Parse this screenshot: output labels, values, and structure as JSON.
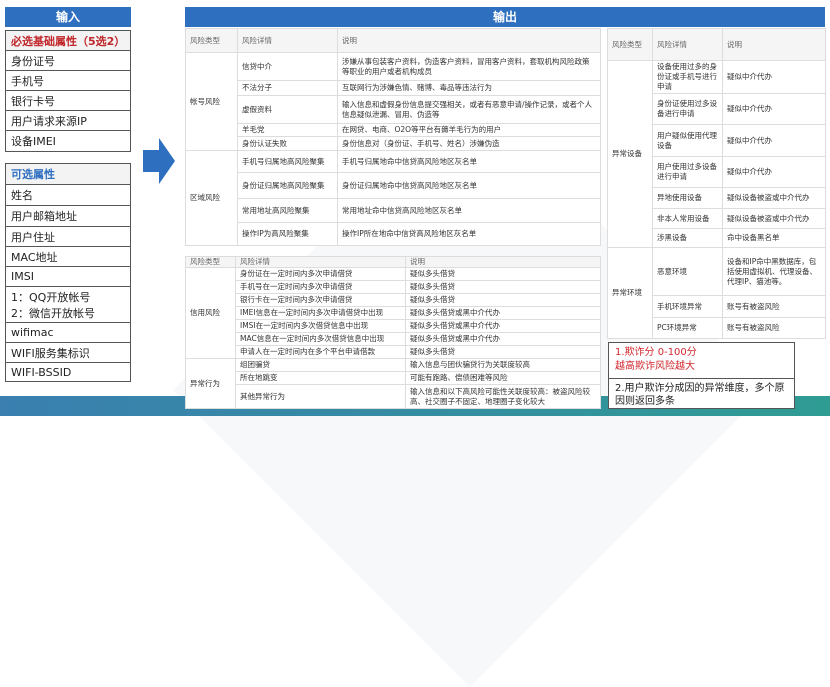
{
  "input": {
    "title": "输入",
    "required_title": "必选基础属性（5选2）",
    "required": [
      "身份证号",
      "手机号",
      "银行卡号",
      "用户请求来源IP",
      "设备IMEI"
    ],
    "optional_title": "可选属性",
    "optional": [
      "姓名",
      "用户邮箱地址",
      "用户住址",
      "MAC地址",
      "IMSI",
      "1：QQ开放帐号",
      "2：微信开放帐号",
      "wifimac",
      "WIFI服务集标识",
      "WIFI-BSSID"
    ]
  },
  "output": {
    "title": "输出"
  },
  "headers": [
    "风险类型",
    "风险详情",
    "说明"
  ],
  "table1": {
    "groups": [
      {
        "type": "帐号风险",
        "rows": [
          [
            "信贷中介",
            "涉嫌从事包装客户资料，伪造客户资料，冒用客户资料，套取机构风险政策等职业的用户或者机构成员"
          ],
          [
            "不法分子",
            "互联网行为涉嫌色情、赌博、毒品等违法行为"
          ],
          [
            "虚假资料",
            "输入信息和虚假身份信息提交强相关，或者有恶意申请/操作记录，或者个人信息疑似泄漏、冒用、伪造等"
          ],
          [
            "羊毛党",
            "在网贷、电商、O2O等平台有薅羊毛行为的用户"
          ],
          [
            "身份认证失败",
            "身份信息对（身份证、手机号、姓名）涉嫌伪造"
          ]
        ]
      },
      {
        "type": "区域风险",
        "rows": [
          [
            "手机号归属地高风险聚集",
            "手机号归属地命中信贷高风险地区灰名单"
          ],
          [
            "身份证归属地高风险聚集",
            "身份证归属地命中信贷高风险地区灰名单"
          ],
          [
            "常用地址高风险聚集",
            "常用地址命中信贷高风险地区灰名单"
          ],
          [
            "操作IP为高风险聚集",
            "操作IP所在地命中信贷高风险地区灰名单"
          ]
        ]
      }
    ]
  },
  "table2": {
    "groups": [
      {
        "type": "信用风险",
        "rows": [
          [
            "身份证在一定时间内多次申请借贷",
            "疑似多头借贷"
          ],
          [
            "手机号在一定时间内多次申请借贷",
            "疑似多头借贷"
          ],
          [
            "银行卡在一定时间内多次申请借贷",
            "疑似多头借贷"
          ],
          [
            "IMEI信息在一定时间内多次申请借贷中出现",
            "疑似多头借贷或黑中介代办"
          ],
          [
            "IMSI在一定时间内多次借贷信息中出现",
            "疑似多头借贷或黑中介代办"
          ],
          [
            "MAC信息在一定时间内多次借贷信息中出现",
            "疑似多头借贷或黑中介代办"
          ],
          [
            "申请人在一定时间内在多个平台申请借款",
            "疑似多头借贷"
          ]
        ]
      },
      {
        "type": "异常行为",
        "rows": [
          [
            "组团骗贷",
            "输入信息与团伙骗贷行为关联度较高"
          ],
          [
            "所在地跳变",
            "可能有跑路、偿债困难等风险"
          ],
          [
            "其他异常行为",
            "输入信息和以下高风险可能性关联度较高：被盗风险较高、社交圈子不固定、地理圈子变化较大"
          ]
        ]
      }
    ]
  },
  "table3": {
    "groups": [
      {
        "type": "异常设备",
        "rows": [
          [
            "设备使用过多的身份证或手机号进行申请",
            "疑似中介代办"
          ],
          [
            "身份证使用过多设备进行申请",
            "疑似中介代办"
          ],
          [
            "用户疑似使用代理设备",
            "疑似中介代办"
          ],
          [
            "用户使用过多设备进行申请",
            "疑似中介代办"
          ],
          [
            "异地使用设备",
            "疑似设备被盗或中介代办"
          ],
          [
            "非本人常用设备",
            "疑似设备被盗或中介代办"
          ],
          [
            "涉黑设备",
            "命中设备黑名单"
          ]
        ]
      },
      {
        "type": "异常环境",
        "rows": [
          [
            "恶意环境",
            "设备和IP命中黑数据库，包括使用虚拟机、代理设备、代理IP、猫池等。"
          ],
          [
            "手机环境异常",
            "账号有被盗风险"
          ],
          [
            "PC环境异常",
            "账号有被盗风险"
          ]
        ]
      }
    ]
  },
  "notes": {
    "line1": "1.欺诈分 0-100分",
    "line2": "越高欺诈风险越大",
    "line3": "2.用户欺诈分成因的异常维度，多个原因则返回多条"
  },
  "colors": {
    "header": "#2e6fc0",
    "required": "#c0262a",
    "note_red": "#d0282e"
  }
}
